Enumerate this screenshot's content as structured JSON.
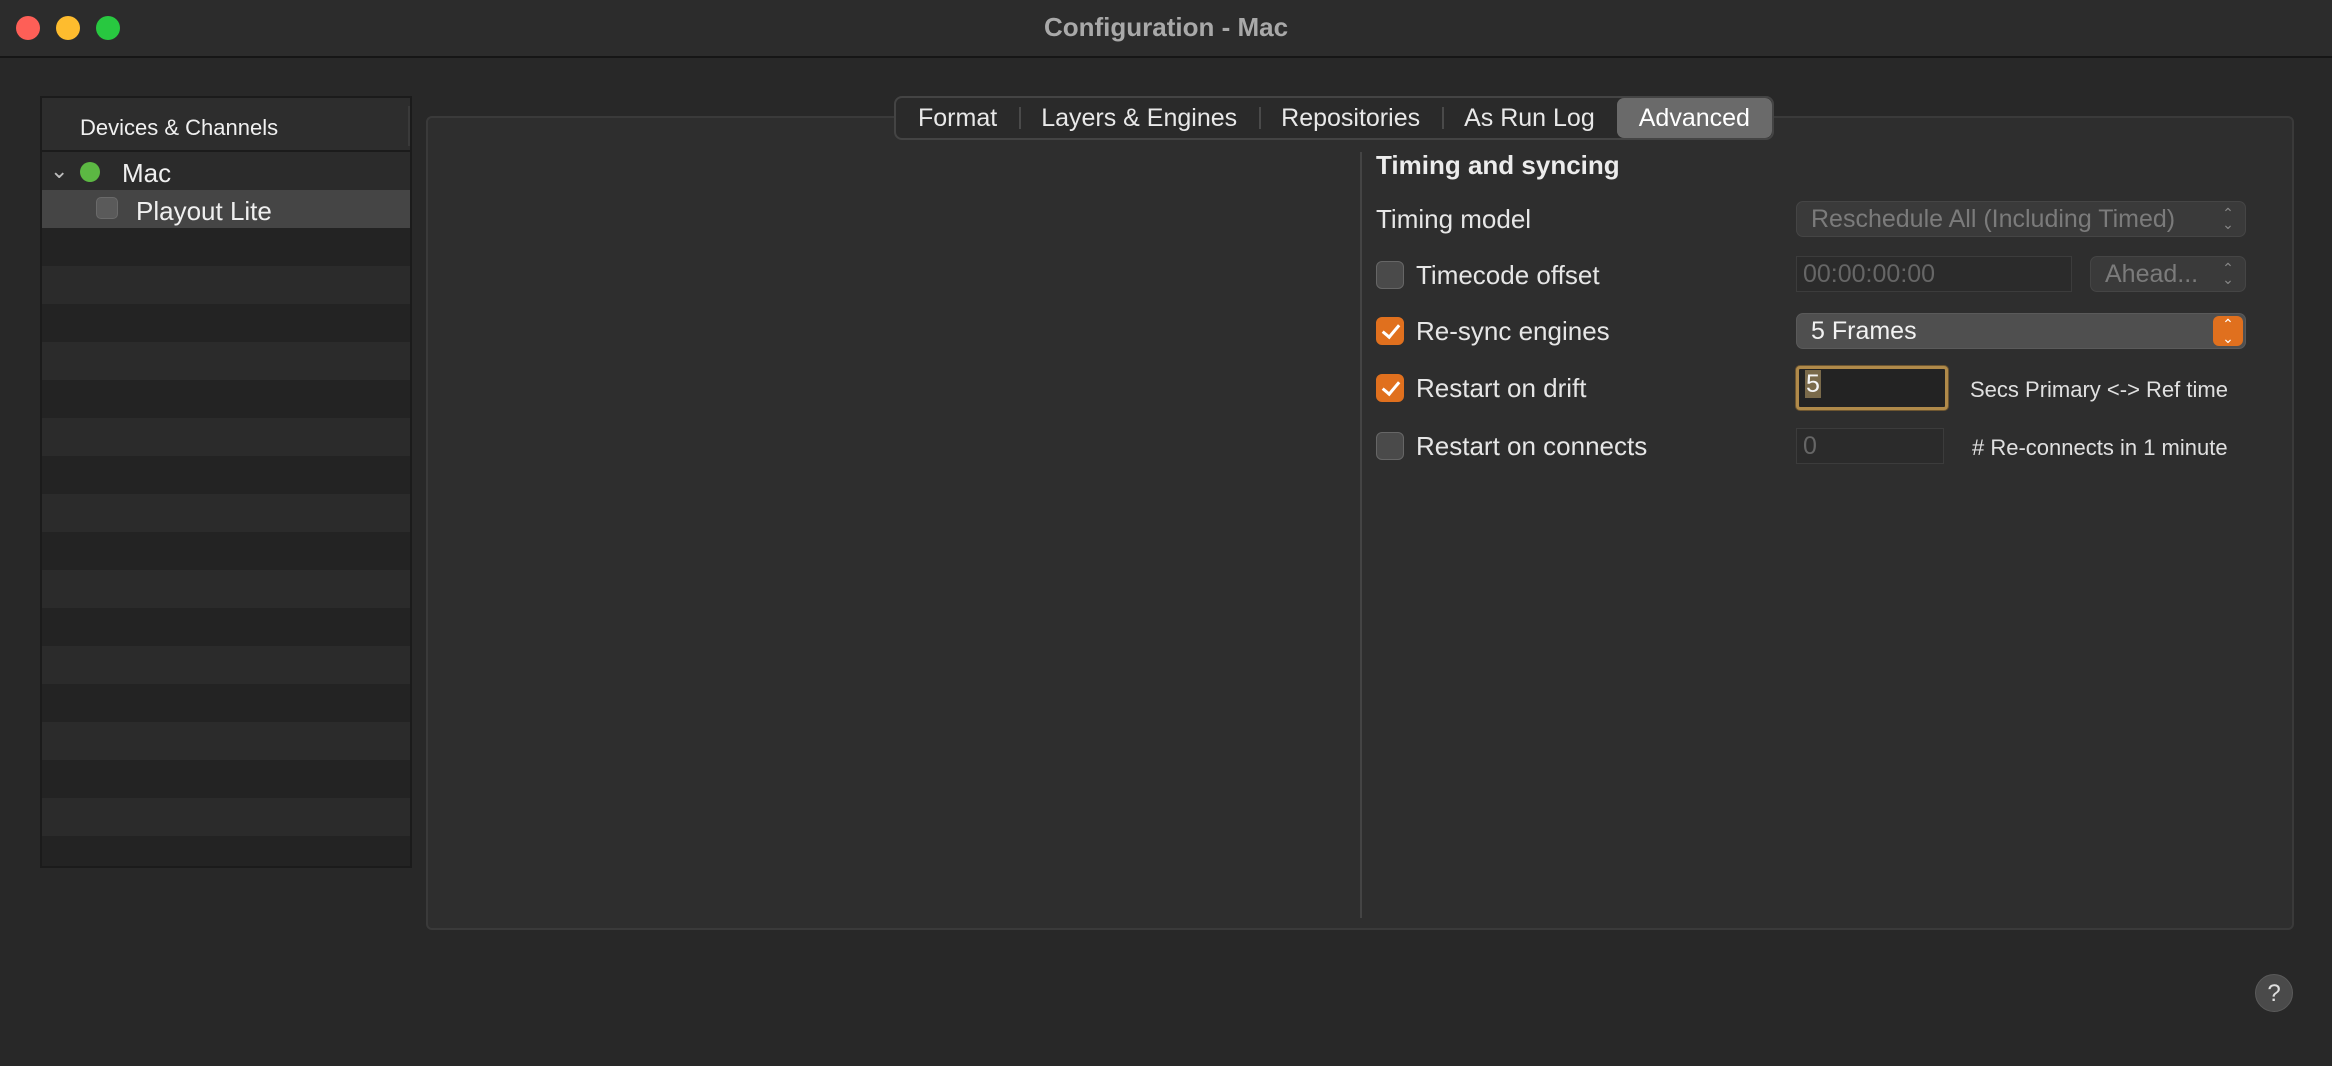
{
  "window": {
    "title": "Configuration - Mac"
  },
  "sidebar": {
    "header": "Devices & Channels",
    "items": [
      {
        "label": "Mac",
        "status": "connected",
        "status_color": "#5cb843",
        "expanded": true
      },
      {
        "label": "Playout Lite",
        "checked": false,
        "selected": true
      }
    ]
  },
  "tabs": [
    {
      "label": "Format",
      "active": false
    },
    {
      "label": "Layers & Engines",
      "active": false
    },
    {
      "label": "Repositories",
      "active": false
    },
    {
      "label": "As Run Log",
      "active": false
    },
    {
      "label": "Advanced",
      "active": true
    }
  ],
  "advanced": {
    "section_title": "Timing and syncing",
    "timing_model": {
      "label": "Timing model",
      "value": "Reschedule All (Including Timed)",
      "enabled": false
    },
    "timecode_offset": {
      "label": "Timecode offset",
      "checked": false,
      "value": "00:00:00:00",
      "direction": "Ahead..."
    },
    "resync_engines": {
      "label": "Re-sync engines",
      "checked": true,
      "value": "5 Frames"
    },
    "restart_on_drift": {
      "label": "Restart on drift",
      "checked": true,
      "value": "5",
      "suffix": "Secs Primary <-> Ref time"
    },
    "restart_on_connects": {
      "label": "Restart on connects",
      "checked": false,
      "value": "0",
      "suffix": "# Re-connects in 1 minute"
    }
  },
  "help": {
    "label": "?"
  },
  "colors": {
    "accent": "#e0701e",
    "background": "#282828"
  }
}
